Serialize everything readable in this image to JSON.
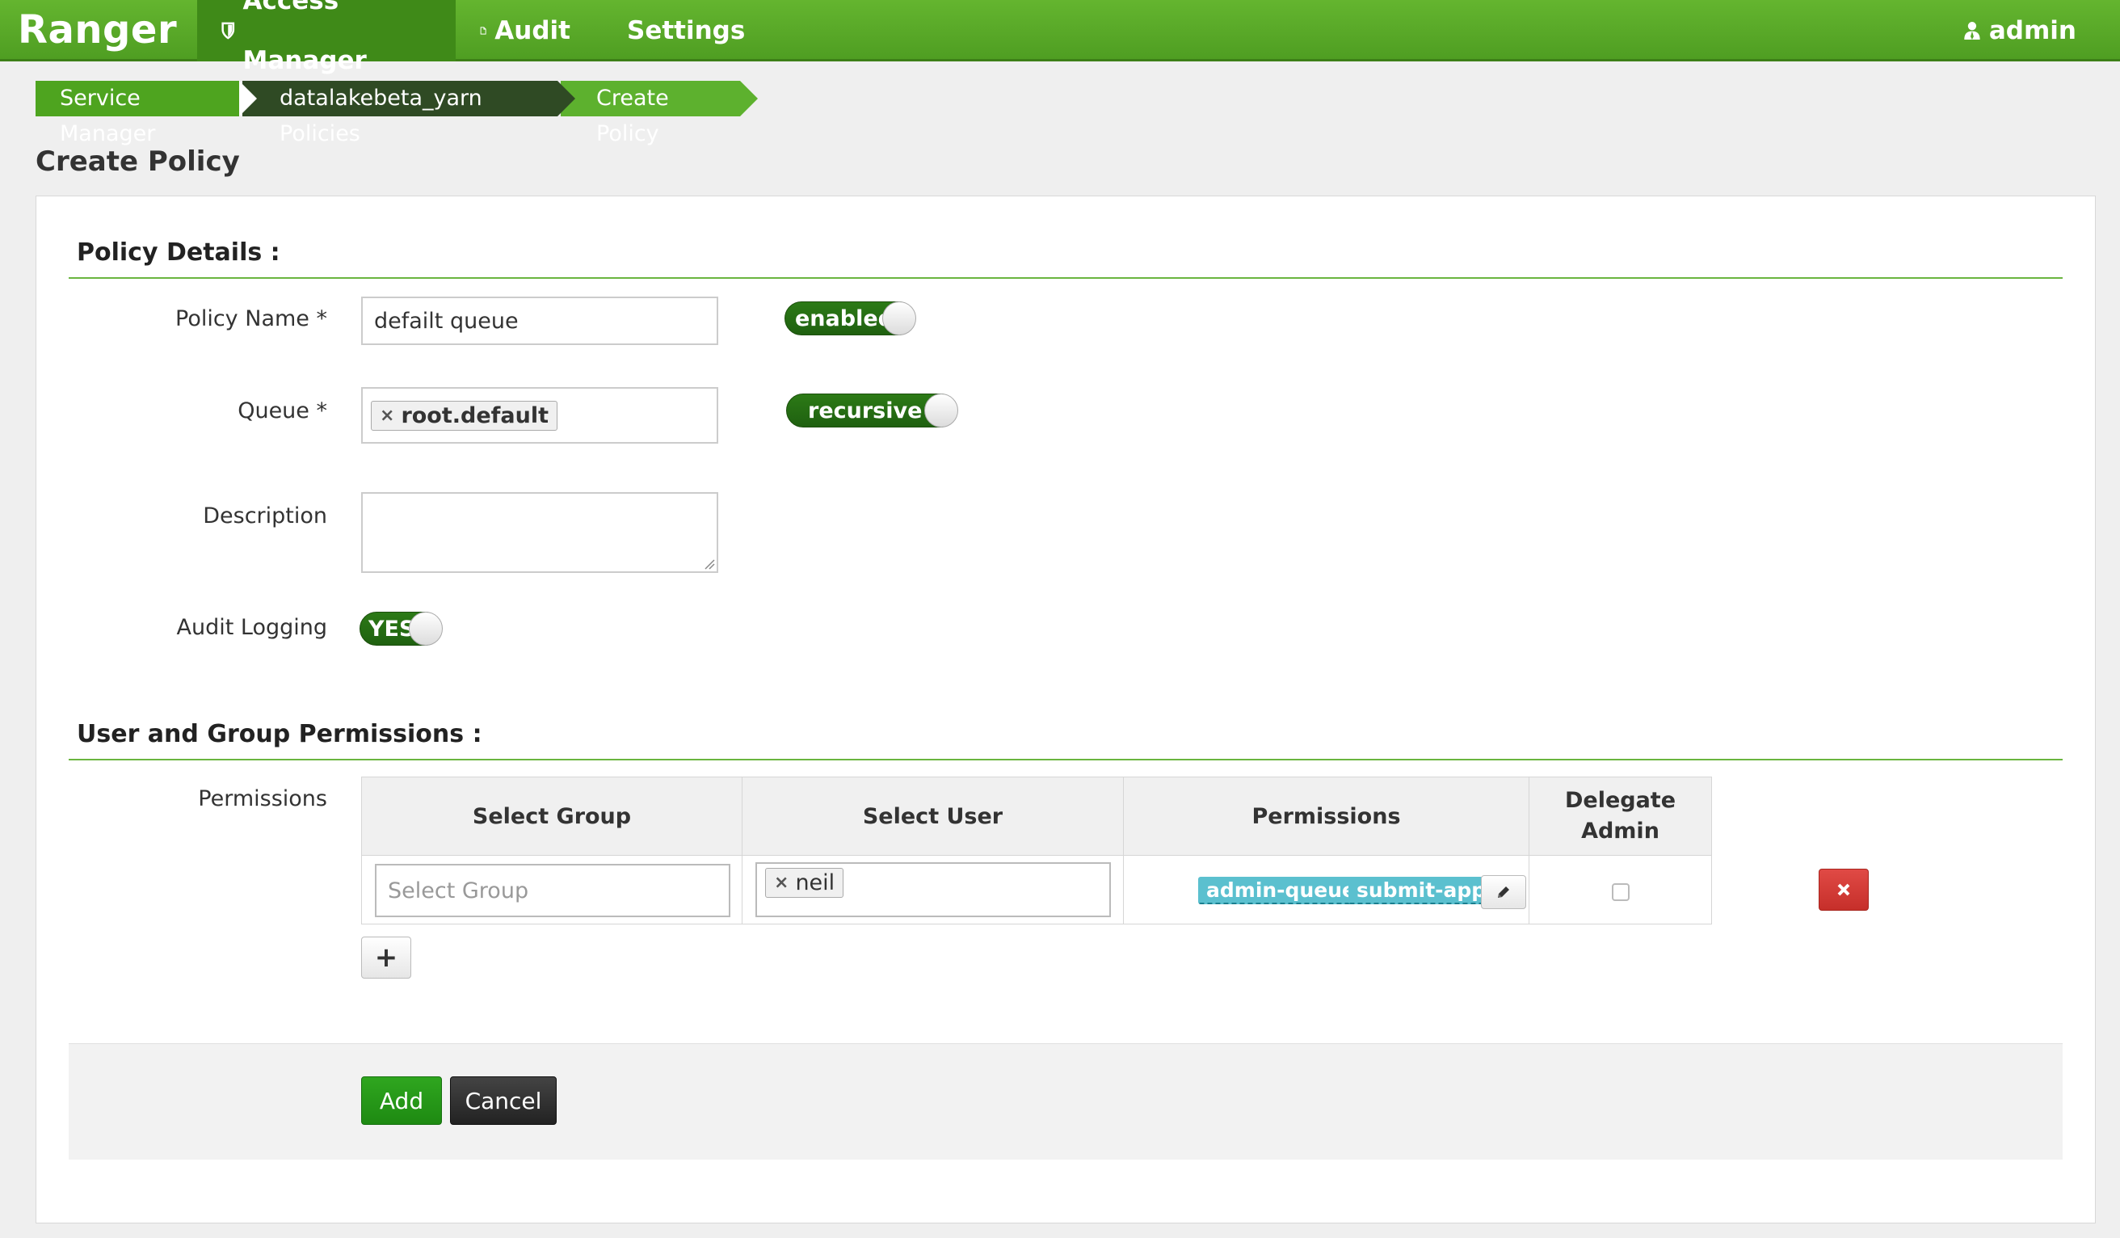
{
  "navbar": {
    "brand": "Ranger",
    "items": [
      {
        "label": "Access Manager",
        "icon": "shield-icon"
      },
      {
        "label": "Audit",
        "icon": "file-icon"
      },
      {
        "label": "Settings",
        "icon": "gear-icon"
      }
    ],
    "user": "admin"
  },
  "breadcrumb": [
    "Service Manager",
    "datalakebeta_yarn Policies",
    "Create Policy"
  ],
  "page_title": "Create Policy",
  "policy_details": {
    "title": "Policy Details :",
    "policy_name_label": "Policy Name *",
    "policy_name_value": "defailt queue",
    "enabled_toggle": "enabled",
    "queue_label": "Queue *",
    "queue_tag": "root.default",
    "recursive_toggle": "recursive",
    "description_label": "Description",
    "description_value": "",
    "audit_label": "Audit Logging",
    "audit_toggle": "YES"
  },
  "permissions": {
    "title": "User and Group Permissions :",
    "label": "Permissions",
    "headers": {
      "group": "Select Group",
      "user": "Select User",
      "permissions": "Permissions",
      "delegate": "Delegate Admin"
    },
    "row": {
      "group_placeholder": "Select Group",
      "user_tag": "neil",
      "perm_tags": [
        "admin-queue",
        "submit-app"
      ],
      "delegate_checked": false
    }
  },
  "buttons": {
    "add_row": "+",
    "add": "Add",
    "cancel": "Cancel"
  },
  "colors": {
    "navbar": "#58aa28",
    "accent": "#6ab53f",
    "toggle": "#2c7a16",
    "perm_tag": "#5bc0cf",
    "delete": "#d2322d"
  }
}
